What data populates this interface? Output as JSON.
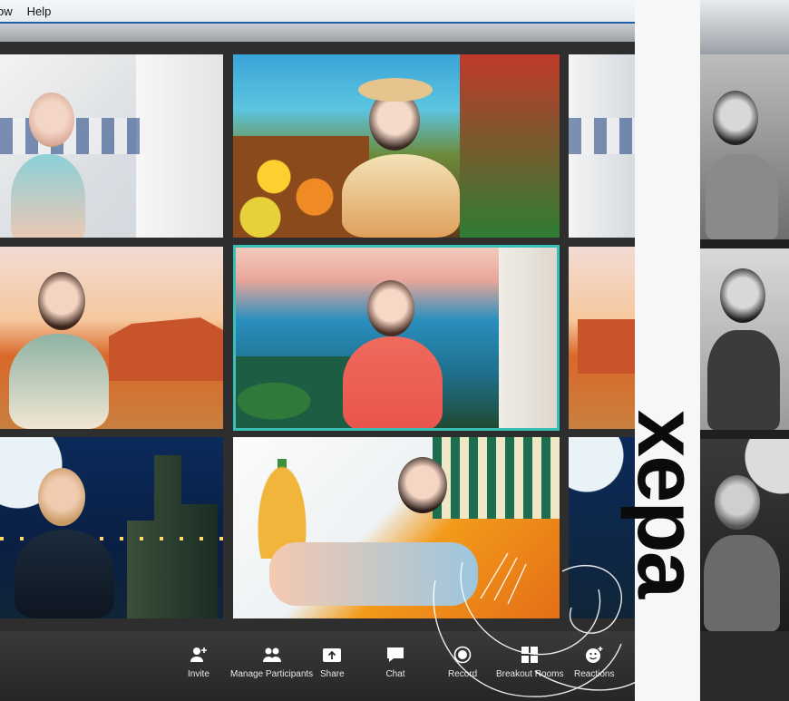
{
  "menu": {
    "items": [
      "ow",
      "Help"
    ]
  },
  "toolbar": {
    "invite": "Invite",
    "manage_participants": "Manage Participants",
    "share": "Share",
    "chat": "Chat",
    "record": "Record",
    "breakout_rooms": "Breakout Rooms",
    "reactions": "Reactions"
  },
  "colors": {
    "active_border": "#39c0b6",
    "menubar_accent": "#1e5fa8",
    "toolbar_bg": "#2b2b2b"
  },
  "overlay": {
    "logo_text": "xepa"
  },
  "icons": [
    "invite-icon",
    "participants-icon",
    "share-icon",
    "chat-icon",
    "record-icon",
    "breakout-rooms-icon",
    "reactions-icon"
  ]
}
